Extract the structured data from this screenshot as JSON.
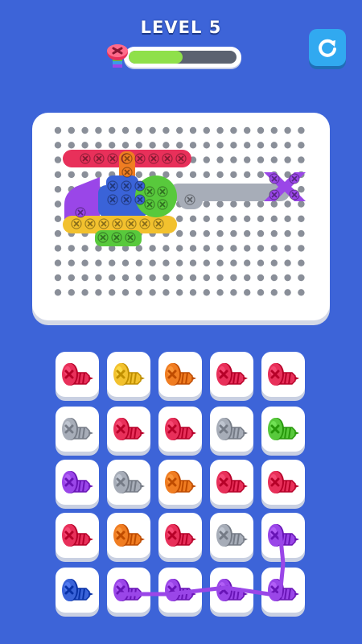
{
  "header": {
    "level_text": "LEVEL 5"
  },
  "progress": {
    "value": 0.5,
    "fill_color": "#8fe04a",
    "track_color": "#5b6270"
  },
  "restart_button": {
    "icon": "restart-icon",
    "color": "#31a9f0"
  },
  "colors": {
    "red": "#e8305a",
    "yellow": "#f2c12e",
    "orange": "#f07d22",
    "gray": "#a7adb8",
    "green": "#58c93c",
    "purple": "#9a46e8",
    "blue": "#3a63d8"
  },
  "tray": {
    "rows": [
      [
        "red",
        "yellow",
        "orange",
        "red",
        "red"
      ],
      [
        "gray",
        "red",
        "red",
        "gray",
        "green"
      ],
      [
        "purple",
        "gray",
        "orange",
        "red",
        "red"
      ],
      [
        "red",
        "orange",
        "red",
        "gray",
        "purple"
      ],
      [
        "blue",
        "purple",
        "purple",
        "purple",
        "purple"
      ]
    ]
  }
}
